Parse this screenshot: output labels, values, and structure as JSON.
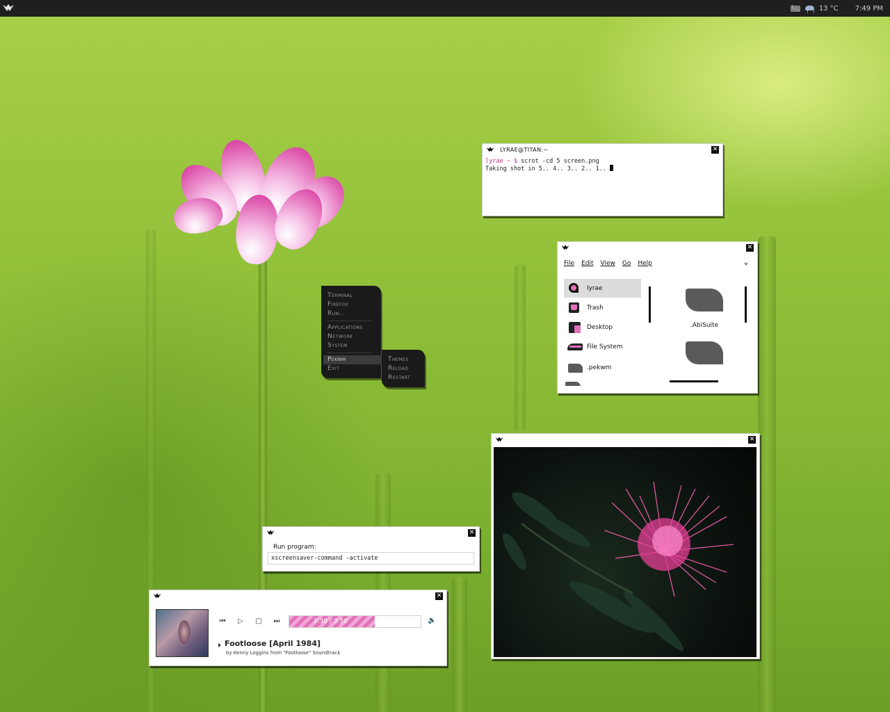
{
  "panel": {
    "temperature": "13 °C",
    "time": "7:49 PM",
    "icons": [
      "pekwm-logo-icon",
      "mail-icon",
      "weather-icon"
    ]
  },
  "terminal": {
    "title": "LYRAE@TITAN:~",
    "prompt": "lyrae ~ $",
    "command": " scrot -cd 5 screen.png",
    "output": "Taking shot in 5.. 4.. 3.. 2.. 1.. "
  },
  "menu": {
    "items": [
      "Terminal",
      "Firefox",
      "Run..",
      "Applications",
      "Network",
      "System",
      "Pekwm",
      "Exit"
    ],
    "submenu": [
      "Themes",
      "Reload",
      "Restart"
    ]
  },
  "filemanager": {
    "menubar": [
      "File",
      "Edit",
      "View",
      "Go",
      "Help"
    ],
    "sidebar": [
      "lyrae",
      "Trash",
      "Desktop",
      "File System",
      ".pekwm"
    ],
    "files": [
      ".AbiSuite"
    ]
  },
  "run_dialog": {
    "label": "Run program:",
    "value": "xscreensaver-command -activate"
  },
  "player": {
    "time": "2:30 / 3:50",
    "progress_fraction": 0.65,
    "song": "Footloose [April 1984]",
    "artist_line": "by Kenny Loggins from \"Footloose\" Soundtrack"
  },
  "colors": {
    "accent": "#e070b8",
    "panel": "#1f1f1f",
    "menu": "#1a1a1a"
  }
}
